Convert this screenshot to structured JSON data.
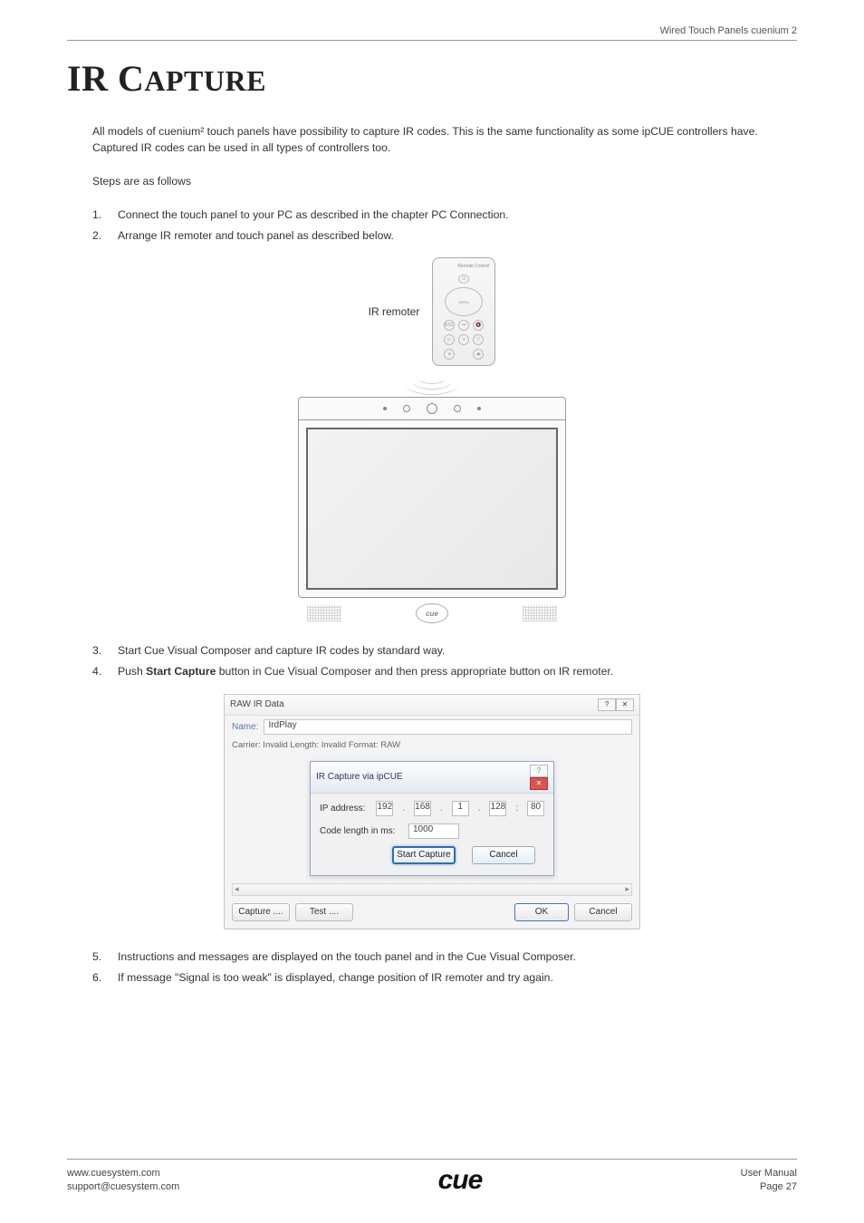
{
  "header": {
    "right": "Wired Touch Panels cuenium 2"
  },
  "title": {
    "main": "IR C",
    "rest": "APTURE"
  },
  "intro": "All models of cuenium² touch panels have possibility to capture IR codes. This is the same functionality as some ipCUE controllers have. Captured IR codes can be used in all types of controllers too.",
  "steps_label": "Steps are as follows",
  "steps1": [
    "Connect the touch panel to your PC as described in the chapter PC Connection.",
    "Arrange IR remoter and touch panel as described below."
  ],
  "figure1": {
    "remote_label": "IR remoter",
    "remote_title": "Remote Control",
    "menu": "MENU",
    "cue": "cue"
  },
  "steps2": [
    "Start Cue Visual Composer and capture IR codes by standard way.",
    "Push Start Capture button in Cue Visual Composer and then press appropriate button on IR remoter."
  ],
  "steps2_bold_prefix": "Push ",
  "steps2_bold": "Start Capture",
  "steps2_bold_suffix": " button in Cue Visual Composer and then press appropriate button on IR remoter.",
  "dialog": {
    "outer_title": "RAW IR Data",
    "name_label": "Name:",
    "name_value": "IrdPlay",
    "meta": "Carrier: Invalid   Length: Invalid   Format: RAW",
    "inner_title": "IR Capture via ipCUE",
    "ip_label": "IP address:",
    "ip": [
      "192",
      "168",
      "1",
      "128"
    ],
    "port_sep": ":",
    "port": "80",
    "len_label": "Code length in ms:",
    "len_value": "1000",
    "start_btn": "Start Capture",
    "cancel_btn": "Cancel",
    "capture_btn": "Capture ....",
    "test_btn": "Test ....",
    "ok_btn": "OK",
    "cancel_btn2": "Cancel"
  },
  "steps3": [
    "Instructions and messages are displayed on the touch panel and in the Cue Visual Composer.",
    "If message \"Signal is too weak\" is displayed, change position of IR remoter and try again."
  ],
  "footer": {
    "site": "www.cuesystem.com",
    "email": "support@cuesystem.com",
    "logo": "cue",
    "manual": "User Manual",
    "page": "Page 27"
  }
}
